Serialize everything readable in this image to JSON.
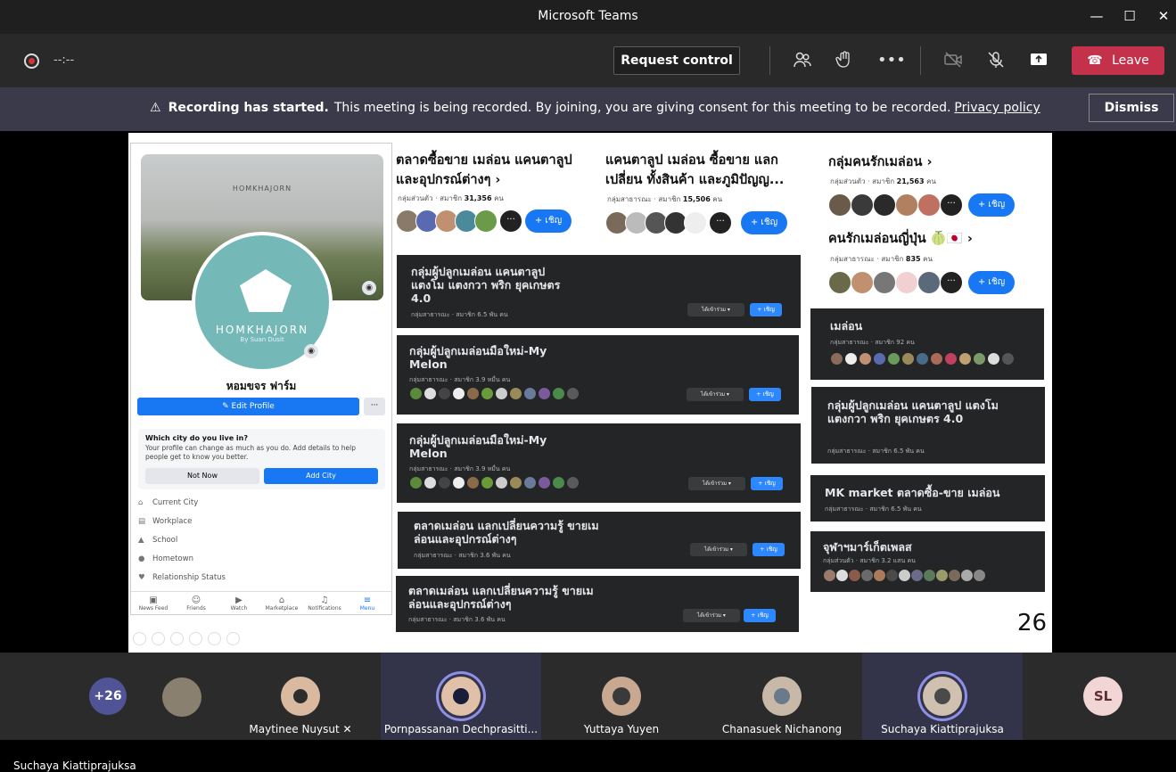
{
  "window": {
    "title": "Microsoft Teams",
    "minimize": "—",
    "maximize": "☐",
    "close": "✕"
  },
  "toolbar": {
    "timer": "--:--",
    "request_control": "Request control",
    "leave": "Leave",
    "leave_icon": "☎"
  },
  "banner": {
    "warning_icon": "⚠",
    "bold": "Recording has started.",
    "message": "This meeting is being recorded. By joining, you are giving consent for this meeting to be recorded.",
    "link": "Privacy policy",
    "dismiss": "Dismiss"
  },
  "slide": {
    "page_number": "26",
    "profile": {
      "brand": "HOMKHAJORN",
      "avatar_name": "HOMKHAJORN",
      "avatar_sub": "By Suan Dusit",
      "name": "หอมขจร ฟาร์ม",
      "edit_profile": "✎ Edit Profile",
      "more": "···",
      "city_question": "Which city do you live in?",
      "city_desc": "Your profile can change as much as you do. Add details to help people get to know you better.",
      "not_now": "Not Now",
      "add_city": "Add City",
      "details": [
        "Current City",
        "Workplace",
        "School",
        "Hometown",
        "Relationship Status"
      ],
      "nav": [
        "News Feed",
        "Friends",
        "Watch",
        "Marketplace",
        "Notifications",
        "Menu"
      ]
    },
    "light_groups": [
      {
        "title": "ตลาดซื้อขาย เมล่อน แคนตาลูป และอุปกรณ์ต่างๆ ›",
        "meta_prefix": "กลุ่มส่วนตัว · สมาชิก ",
        "members": "31,356",
        "meta_suffix": " คน",
        "invite": "+ เชิญ"
      },
      {
        "title": "แคนตาลูป เมล่อน ซื้อขาย แลกเปลี่ยน ทั้งสินค้า และภูมิปัญญ...",
        "meta_prefix": "กลุ่มสาธารณะ · สมาชิก ",
        "members": "15,506",
        "meta_suffix": " คน",
        "invite": "+ เชิญ"
      },
      {
        "title": "กลุ่มคนรักเมล่อน ›",
        "meta_prefix": "กลุ่มส่วนตัว · สมาชิก ",
        "members": "21,563",
        "meta_suffix": " คน",
        "invite": "+ เชิญ"
      },
      {
        "title": "คนรักเมล่อนญี่ปุ่น 🍈🇯🇵 ›",
        "meta_prefix": "กลุ่มสาธารณะ · สมาชิก ",
        "members": "835",
        "meta_suffix": " คน",
        "invite": "+ เชิญ"
      }
    ],
    "dark_groups": [
      {
        "title": "กลุ่มผู้ปลูกเมล่อน แคนตาลูป แตงโม แตงกวา พริก ยุคเกษตร 4.0",
        "meta": "กลุ่มสาธารณะ · สมาชิก 6.5 พัน คน",
        "joined": "ได้เข้าร่วม ▾",
        "invite": "+ เชิญ"
      },
      {
        "title": "กลุ่มผู้ปลูกเมล่อนมือใหม่-My Melon",
        "meta": "กลุ่มสาธารณะ · สมาชิก 3.9 หมื่น คน",
        "joined": "ได้เข้าร่วม ▾",
        "invite": "+ เชิญ"
      },
      {
        "title": "กลุ่มผู้ปลูกเมล่อนมือใหม่-My Melon",
        "meta": "กลุ่มสาธารณะ · สมาชิก 3.9 หมื่น คน",
        "joined": "ได้เข้าร่วม ▾",
        "invite": "+ เชิญ"
      },
      {
        "title": "ตลาดเมล่อน แลกเปลี่ยนความรู้ ขายเมล่อนและอุปกรณ์ต่างๆ",
        "meta": "กลุ่มสาธารณะ · สมาชิก 3.6 พัน คน",
        "joined": "ได้เข้าร่วม ▾",
        "invite": "+ เชิญ"
      },
      {
        "title": "ตลาดเมล่อน แลกเปลี่ยนความรู้ ขายเมล่อนและอุปกรณ์ต่างๆ",
        "meta": "กลุ่มสาธารณะ · สมาชิก 3.6 พัน คน",
        "joined": "ได้เข้าร่วม ▾",
        "invite": "+ เชิญ"
      },
      {
        "title": "เมล่อน",
        "meta": "กลุ่มสาธารณะ · สมาชิก 92 คน"
      },
      {
        "title": "กลุ่มผู้ปลูกเมล่อน แคนตาลูป แตงโม แตงกวา พริก ยุคเกษตร 4.0",
        "meta": "กลุ่มสาธารณะ · สมาชิก 6.5 พัน คน"
      },
      {
        "title": "MK market ตลาดซื้อ-ขาย เมล่อน",
        "meta": "กลุ่มสาธารณะ · สมาชิก 6.5 พัน คน"
      },
      {
        "title": "จุฬาฯมาร์เก็ตเพลส",
        "meta": "กลุ่มส่วนตัว · สมาชิก 3.2 แสน คน"
      }
    ]
  },
  "speaker": "Suchaya Kiattiprajuksa",
  "participants": {
    "overflow": "+26",
    "tiles": [
      {
        "name": "Maytinee Nuysut"
      },
      {
        "name": "Pornpassanan Dechprasitti..."
      },
      {
        "name": "Yuttaya Yuyen"
      },
      {
        "name": "Chanasuek Nichanong"
      },
      {
        "name": "Suchaya Kiattiprajuksa"
      }
    ],
    "initials": "SL"
  },
  "colors": {
    "leave": "#c4314b",
    "fb_blue": "#1877f2",
    "speaking_ring": "#8f8fe8"
  }
}
